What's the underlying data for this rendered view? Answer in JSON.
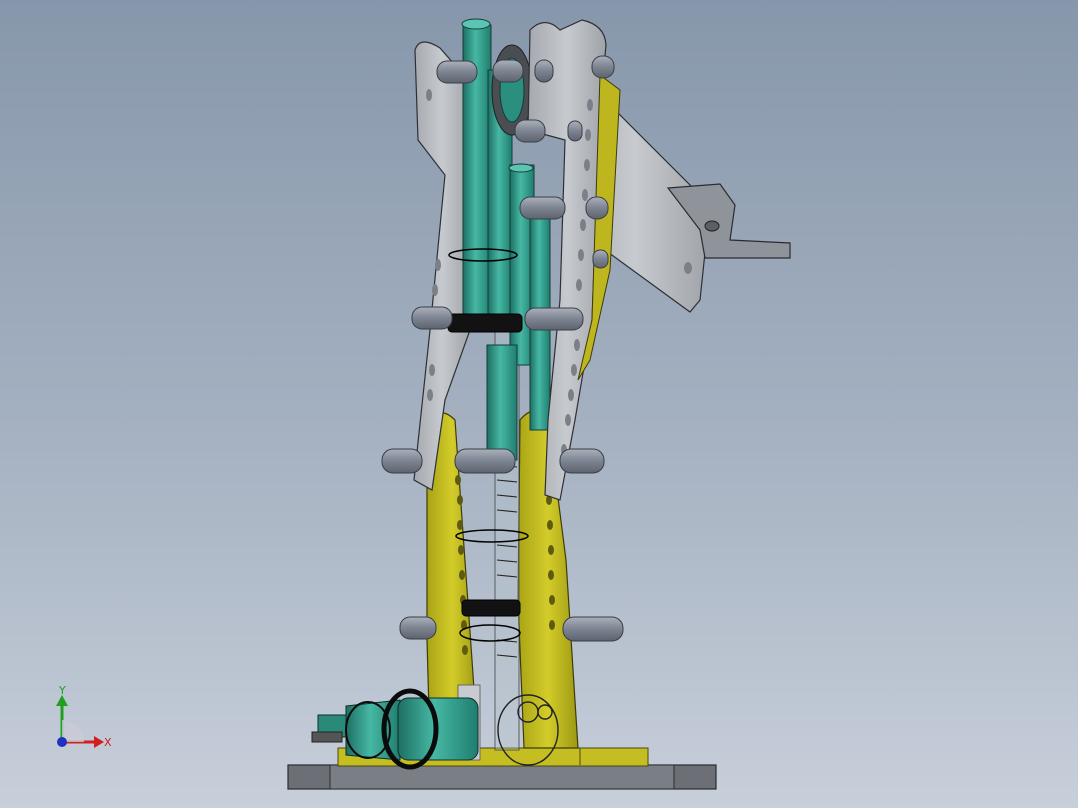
{
  "viewport": {
    "background_top": "#8797ab",
    "background_bottom": "#c7cfda"
  },
  "model": {
    "parts": [
      "base-plate",
      "motor",
      "drive-pulley",
      "lower-arm-yellow-left",
      "lower-arm-yellow-right",
      "upper-arm-grey-left",
      "upper-arm-grey-right",
      "hydraulic-cylinder-teal",
      "spring",
      "forearm",
      "gripper"
    ],
    "colors": {
      "yellow_link": "#c9c21e",
      "grey_link": "#b9bcc1",
      "teal_cylinder": "#2f9a88",
      "pin": "#8f96a3",
      "base": "#6f7379",
      "belt": "#141414"
    }
  },
  "triad": {
    "x_label": "X",
    "y_label": "Y",
    "x_color": "#d02020",
    "y_color": "#20a020",
    "z_color": "#2030c0"
  }
}
